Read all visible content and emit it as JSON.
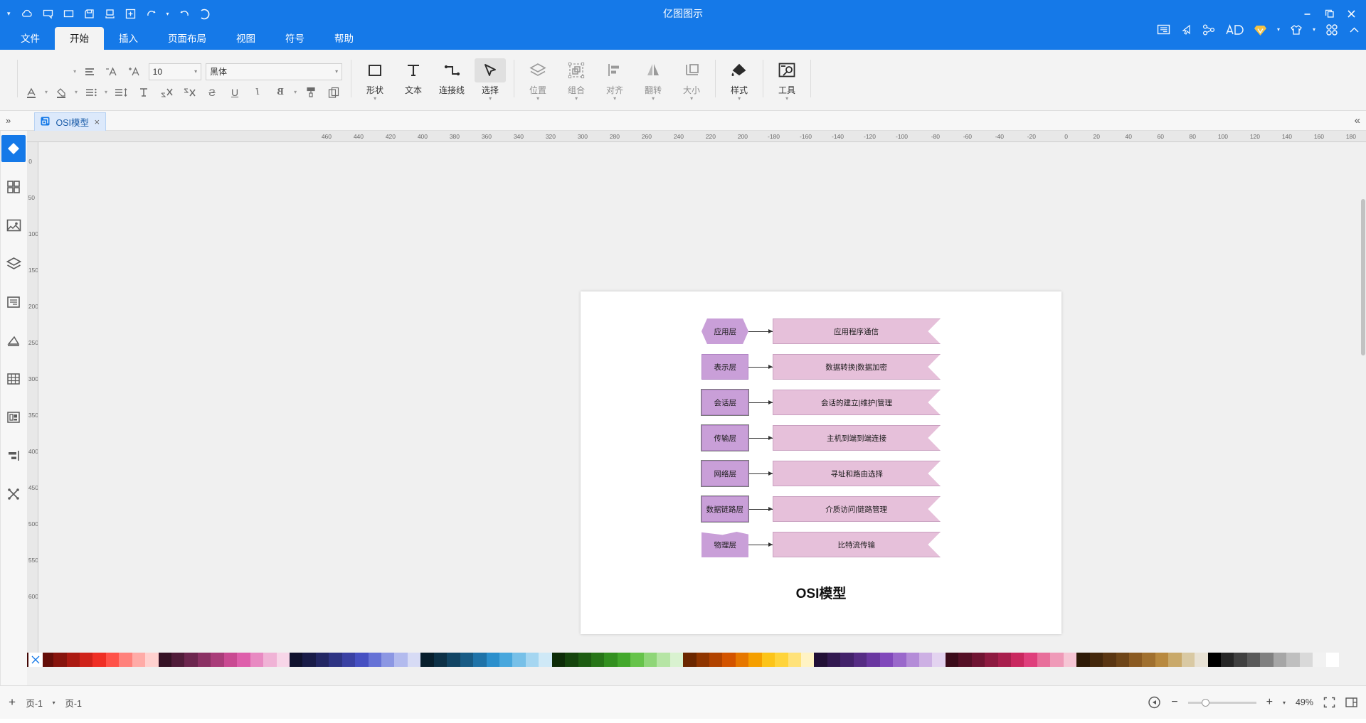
{
  "app": {
    "title": "亿图图示",
    "titlebar_icons_left": [
      "close-icon",
      "restore-icon",
      "minimize-icon"
    ],
    "titlebar_icons_right": [
      "chevron-down-icon",
      "cloud-icon",
      "comment-icon",
      "present-icon",
      "save-icon",
      "export-icon",
      "new-icon",
      "undo-icon",
      "redo-icon",
      "account-icon"
    ]
  },
  "quick_access": {
    "items": [
      "collapse-up-icon",
      "apps-icon",
      "apps-caret-icon",
      "theme-icon",
      "theme-caret-icon",
      "vip-icon",
      "ai-icon",
      "share-icon",
      "cursor-icon",
      "feedback-icon"
    ]
  },
  "tabs": [
    {
      "label": "文件",
      "active": false
    },
    {
      "label": "开始",
      "active": true
    },
    {
      "label": "插入",
      "active": false
    },
    {
      "label": "页面布局",
      "active": false
    },
    {
      "label": "视图",
      "active": false
    },
    {
      "label": "符号",
      "active": false
    },
    {
      "label": "帮助",
      "active": false
    }
  ],
  "ribbon": {
    "groups": [
      {
        "buttons": [
          {
            "label": "工具",
            "icon": "tools-icon",
            "caret": true,
            "dark": true
          }
        ]
      },
      {
        "buttons": [
          {
            "label": "样式",
            "icon": "paint-bucket-icon",
            "caret": true,
            "dark": true
          }
        ]
      },
      {
        "buttons": [
          {
            "label": "大小",
            "icon": "size-icon",
            "caret": true,
            "dark": false
          },
          {
            "label": "翻转",
            "icon": "flip-icon",
            "caret": true,
            "dark": false
          },
          {
            "label": "对齐",
            "icon": "align-icon",
            "caret": true,
            "dark": false
          },
          {
            "label": "组合",
            "icon": "group-icon",
            "caret": true,
            "dark": false
          },
          {
            "label": "位置",
            "icon": "layers-icon",
            "caret": true,
            "dark": false
          }
        ]
      },
      {
        "buttons": [
          {
            "label": "选择",
            "icon": "select-arrow-icon",
            "caret": true,
            "dark": true,
            "selected": true
          },
          {
            "label": "连接线",
            "icon": "connector-icon",
            "caret": false,
            "dark": true
          },
          {
            "label": "文本",
            "icon": "text-icon",
            "caret": false,
            "dark": true
          },
          {
            "label": "形状",
            "icon": "shape-icon",
            "caret": true,
            "dark": true
          }
        ]
      }
    ],
    "font": {
      "family_value": "黑体",
      "size_value": "10",
      "row1_icons": [
        "line-spacing-icon",
        "decrease-font-icon",
        "increase-font-icon"
      ],
      "row2_icons": [
        "font-color-icon",
        "highlight-icon",
        "bullets-icon",
        "line-height-icon",
        "clear-format-icon",
        "subscript-icon",
        "superscript-icon",
        "strikethrough-icon",
        "underline-icon",
        "italic-icon",
        "bold-icon",
        "format-painter-icon",
        "copy-icon"
      ]
    }
  },
  "doc_tab": {
    "label": "OSI模型",
    "close": "×",
    "collapse_icon": "chevron-collapse-icon",
    "expand_icon": "chevron-expand-icon"
  },
  "left_rail": [
    {
      "name": "shapes-panel",
      "icon": "diamond-icon",
      "active": true
    },
    {
      "name": "templates-panel",
      "icon": "grid-icon",
      "active": false
    },
    {
      "name": "images-panel",
      "icon": "image-icon",
      "active": false
    },
    {
      "name": "layers-panel",
      "icon": "layers-stack-icon",
      "active": false
    },
    {
      "name": "notes-panel",
      "icon": "note-icon",
      "active": false
    },
    {
      "name": "chart-panel",
      "icon": "chart-icon",
      "active": false
    },
    {
      "name": "table-panel",
      "icon": "table-icon",
      "active": false
    },
    {
      "name": "container-panel",
      "icon": "container-icon",
      "active": false
    },
    {
      "name": "align-panel",
      "icon": "align-panel-icon",
      "active": false
    },
    {
      "name": "connect-panel",
      "icon": "connect-panel-icon",
      "active": false
    }
  ],
  "ruler": {
    "h_ticks": [
      "180",
      "160",
      "140",
      "120",
      "100",
      "80",
      "60",
      "40",
      "20",
      "0",
      "-20",
      "-40",
      "-60",
      "-80",
      "-100",
      "-120",
      "-140",
      "-160",
      "-180",
      "200",
      "220",
      "240",
      "260",
      "280",
      "300",
      "320",
      "340",
      "360",
      "380",
      "400",
      "420",
      "440",
      "460"
    ],
    "v_ticks": [
      "0",
      "50",
      "100",
      "150",
      "200",
      "250",
      "300",
      "350",
      "400",
      "450",
      "500",
      "550",
      "600"
    ]
  },
  "diagram": {
    "title": "OSI模型",
    "rows": [
      {
        "layer": "应用层",
        "desc": "应用程序通信",
        "shape": "hexagon"
      },
      {
        "layer": "表示层",
        "desc": "数据转换|数据加密",
        "shape": "rect"
      },
      {
        "layer": "会话层",
        "desc": "会话的建立|维护|管理",
        "shape": "rect"
      },
      {
        "layer": "传输层",
        "desc": "主机到端到端连接",
        "shape": "rect"
      },
      {
        "layer": "网络层",
        "desc": "寻址和路由选择",
        "shape": "rect"
      },
      {
        "layer": "数据链路层",
        "desc": "介质访问|链路管理",
        "shape": "rect"
      },
      {
        "layer": "物理层",
        "desc": "比特流传输",
        "shape": "wave"
      }
    ],
    "colors": {
      "chevron_fill": "#e6c0da",
      "chevron_stroke": "#c9a0c0",
      "layer_fill": "#c99fd8",
      "layer_stroke": "#b084c4",
      "connector": "#333333"
    }
  },
  "statusbar": {
    "page_label_left": "页-1",
    "page_label_right": "页-1",
    "zoom_level": "49%",
    "add_page": "+",
    "zoom_out": "−",
    "zoom_in": "+",
    "fit_icon": "fit-page-icon",
    "fullscreen_icon": "fullscreen-icon",
    "play_icon": "play-icon",
    "page_caret": "caret-down-icon",
    "grid_icon": "grid-view-icon",
    "cut_icon": "scissors-icon"
  }
}
